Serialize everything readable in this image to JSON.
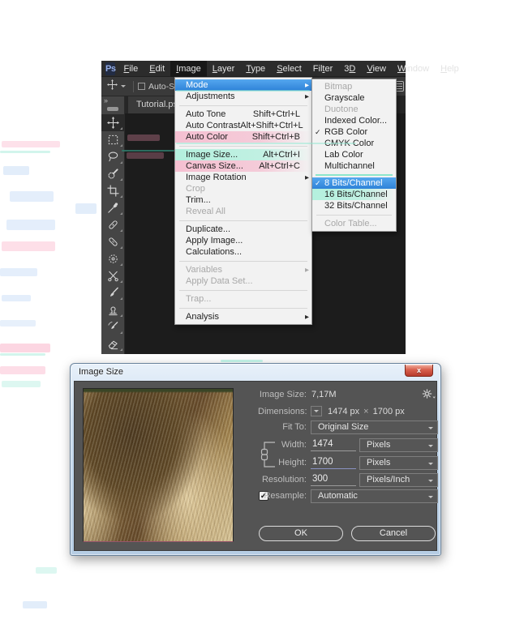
{
  "app": {
    "logo": "Ps"
  },
  "icons": {
    "check": "✓",
    "submenu_arrow": "▶",
    "close": "x",
    "collapse": "»"
  },
  "menu_bar": {
    "items": [
      {
        "label": "File",
        "u": 0
      },
      {
        "label": "Edit",
        "u": 0
      },
      {
        "label": "Image",
        "u": 0,
        "active": true
      },
      {
        "label": "Layer",
        "u": 0
      },
      {
        "label": "Type",
        "u": 0
      },
      {
        "label": "Select",
        "u": 0
      },
      {
        "label": "Filter",
        "u": 3
      },
      {
        "label": "3D",
        "u": 1
      },
      {
        "label": "View",
        "u": 0
      },
      {
        "label": "Window",
        "u": 0
      },
      {
        "label": "Help",
        "u": 0
      }
    ]
  },
  "options_bar": {
    "auto_select_label": "Auto-Select"
  },
  "tab": {
    "title": "Tutorial.psd"
  },
  "tools": [
    "move",
    "rectangular-marquee",
    "lasso",
    "quick-selection",
    "crop",
    "eyedropper",
    "spot-healing-brush",
    "healing-brush",
    "pattern-stamp",
    "scissors",
    "brush",
    "clone-stamp",
    "history-brush",
    "eraser"
  ],
  "image_menu": {
    "items": [
      {
        "label": "Mode",
        "highlighted": true,
        "submenu": true
      },
      {
        "label": "Adjustments",
        "submenu": true
      },
      {
        "type": "separator"
      },
      {
        "label": "Auto Tone",
        "shortcut": "Shift+Ctrl+L"
      },
      {
        "label": "Auto Contrast",
        "shortcut": "Alt+Shift+Ctrl+L"
      },
      {
        "label": "Auto Color",
        "shortcut": "Shift+Ctrl+B",
        "tint": "pink"
      },
      {
        "type": "separator"
      },
      {
        "label": "Image Size...",
        "shortcut": "Alt+Ctrl+I",
        "tint": "mint"
      },
      {
        "label": "Canvas Size...",
        "shortcut": "Alt+Ctrl+C",
        "tint": "pink"
      },
      {
        "label": "Image Rotation",
        "submenu": true
      },
      {
        "label": "Crop",
        "disabled": true
      },
      {
        "label": "Trim..."
      },
      {
        "label": "Reveal All",
        "disabled": true
      },
      {
        "type": "separator"
      },
      {
        "label": "Duplicate..."
      },
      {
        "label": "Apply Image..."
      },
      {
        "label": "Calculations..."
      },
      {
        "type": "separator"
      },
      {
        "label": "Variables",
        "disabled": true,
        "submenu": true
      },
      {
        "label": "Apply Data Set...",
        "disabled": true
      },
      {
        "type": "separator"
      },
      {
        "label": "Trap...",
        "disabled": true
      },
      {
        "type": "separator"
      },
      {
        "label": "Analysis",
        "submenu": true
      }
    ]
  },
  "mode_submenu": {
    "items": [
      {
        "label": "Bitmap",
        "disabled": true
      },
      {
        "label": "Grayscale"
      },
      {
        "label": "Duotone",
        "disabled": true
      },
      {
        "label": "Indexed Color..."
      },
      {
        "label": "RGB Color",
        "checked": true
      },
      {
        "label": "CMYK Color"
      },
      {
        "label": "Lab Color"
      },
      {
        "label": "Multichannel"
      },
      {
        "type": "separator",
        "tint": "mint"
      },
      {
        "label": "8 Bits/Channel",
        "checked": true,
        "highlighted": true
      },
      {
        "label": "16 Bits/Channel",
        "tint": "mint"
      },
      {
        "label": "32 Bits/Channel"
      },
      {
        "type": "separator"
      },
      {
        "label": "Color Table...",
        "disabled": true
      }
    ]
  },
  "dialog": {
    "title": "Image Size",
    "image_size_label": "Image Size:",
    "image_size_value": "7,17M",
    "dimensions_label": "Dimensions:",
    "dimensions_width": "1474 px",
    "dimensions_sep": "×",
    "dimensions_height": "1700 px",
    "fit_to_label": "Fit To:",
    "fit_to_value": "Original Size",
    "width_label": "Width:",
    "width_value": "1474",
    "width_unit": "Pixels",
    "height_label": "Height:",
    "height_value": "1700",
    "height_unit": "Pixels",
    "resolution_label": "Resolution:",
    "resolution_value": "300",
    "resolution_unit": "Pixels/Inch",
    "resample_label": "Resample:",
    "resample_value": "Automatic",
    "ok_label": "OK",
    "cancel_label": "Cancel"
  },
  "colors": {
    "menu_highlight": "#3c95e5",
    "dialog_bg": "#545454",
    "aero_frame": "#c8dbee",
    "close_red": "#c9473a",
    "tint_pink": "#f894b4",
    "tint_mint": "#8ce6cb",
    "ps_accent": "#96aee6"
  }
}
